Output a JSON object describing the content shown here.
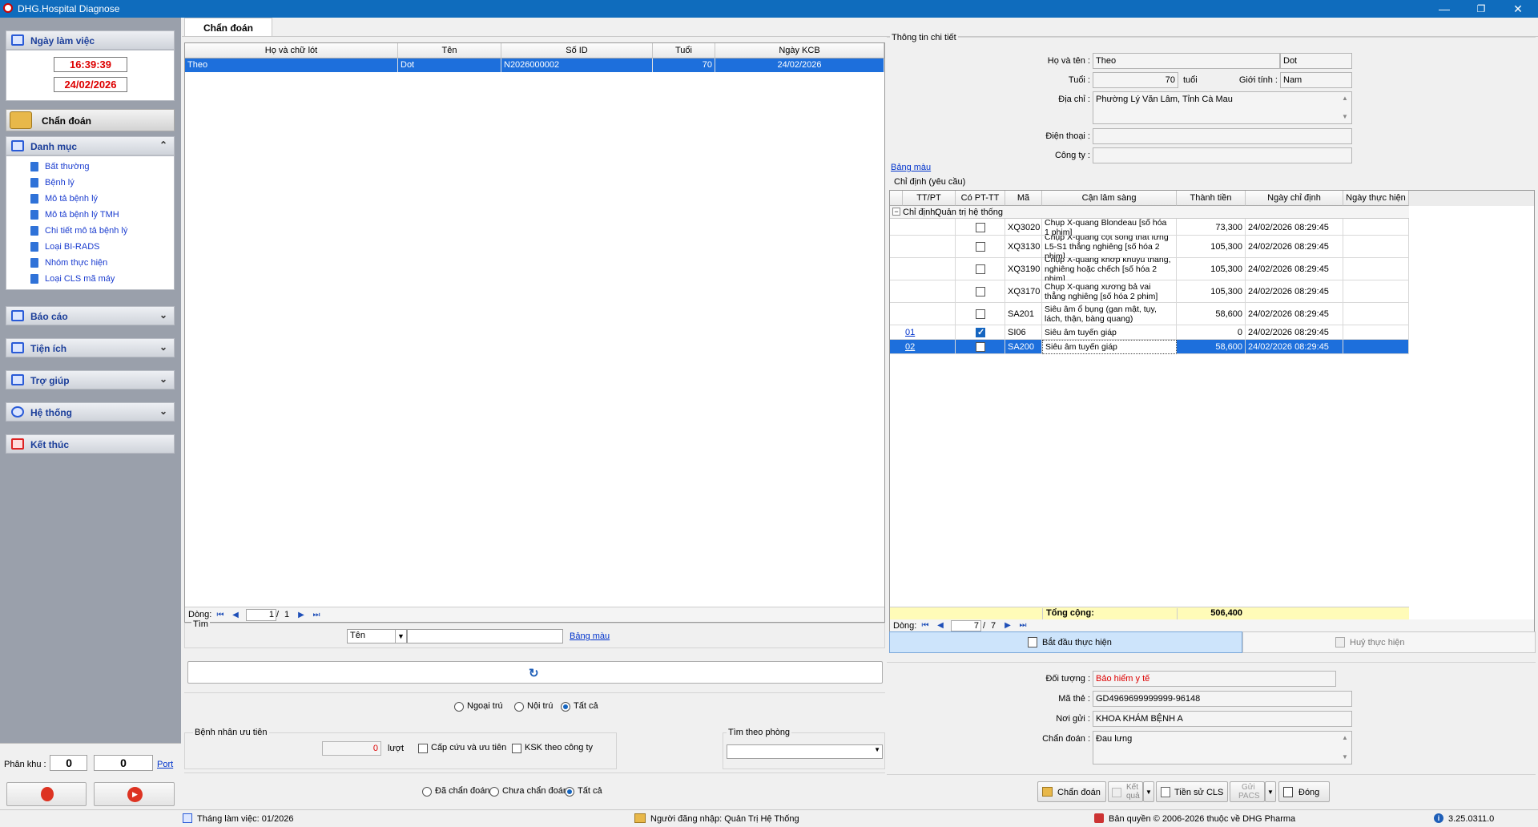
{
  "window": {
    "title": "DHG.Hospital Diagnose"
  },
  "sidebar": {
    "workday_title": "Ngày làm việc",
    "time": "16:39:39",
    "date": "24/02/2026",
    "diagnose_label": "Chẩn đoán",
    "catalog_title": "Danh mục",
    "catalog_items": [
      "Bất thường",
      "Bệnh lý",
      "Mô tả bệnh lý",
      "Mô tả bệnh lý TMH",
      "Chi tiết mô tả bệnh lý",
      "Loại BI-RADS",
      "Nhóm thực hiện",
      "Loại CLS mã máy"
    ],
    "report_title": "Báo cáo",
    "utility_title": "Tiện ích",
    "help_title": "Trợ giúp",
    "system_title": "Hệ thống",
    "exit_title": "Kết thúc",
    "zone_label": "Phân khu :",
    "zone_value1": "0",
    "zone_value2": "0",
    "port_link": "Port"
  },
  "tab": {
    "label": "Chẩn đoán"
  },
  "patient_grid": {
    "headers": [
      "Họ và chữ lót",
      "Tên",
      "Số ID",
      "Tuổi",
      "Ngày KCB"
    ],
    "rows": [
      [
        "Theo",
        "Dot",
        "N2026000002",
        "70",
        "24/02/2026"
      ]
    ],
    "nav_label": "Dòng:",
    "page_current": "1",
    "page_total": "1"
  },
  "search": {
    "title": "Tìm",
    "field_select": "Tên",
    "value": "",
    "color_link": "Bảng màu"
  },
  "filters": {
    "visit_options": [
      "Ngoại trú",
      "Nội trú",
      "Tất cả"
    ],
    "priority_title": "Bệnh nhân ưu tiên",
    "priority_count": "0",
    "priority_unit": "lượt",
    "emergency_label": "Cấp cứu và ưu tiên",
    "ksk_label": "KSK theo công ty",
    "room_title": "Tìm theo phòng",
    "room_value": "",
    "diag_options": [
      "Đã chẩn đoán",
      "Chưa chẩn đoán",
      "Tất cả"
    ]
  },
  "details": {
    "title": "Thông tin chi tiết",
    "name_label": "Họ và tên :",
    "last_name": "Theo",
    "first_name": "Dot",
    "age_label": "Tuổi :",
    "age": "70",
    "age_unit": "tuổi",
    "gender_label": "Giới tính :",
    "gender": "Nam",
    "address_label": "Địa chỉ :",
    "address": "Phường Lý Văn Lâm, Tỉnh Cà Mau",
    "phone_label": "Điện thoại :",
    "phone": "",
    "company_label": "Công ty :",
    "company": "",
    "color_link": "Bảng màu"
  },
  "orders": {
    "title": "Chỉ định (yêu cầu)",
    "headers": [
      "TT/PT",
      "Có PT-TT",
      "Mã",
      "Cận lâm sàng",
      "Thành tiền",
      "Ngày chỉ định",
      "Ngày thực hiện"
    ],
    "group_label": "Chỉ định:",
    "group_value": "Quản trị hệ thống",
    "rows": [
      {
        "tt": "",
        "checked": false,
        "code": "XQ3020",
        "name": "Chụp X-quang Blondeau [số hóa 1 phim]",
        "price": "73,300",
        "date": "24/02/2026 08:29:45",
        "done": ""
      },
      {
        "tt": "",
        "checked": false,
        "code": "XQ3130",
        "name": "Chụp X-quang cột sống thắt lưng L5-S1 thẳng nghiêng [số hóa 2 phim]",
        "price": "105,300",
        "date": "24/02/2026 08:29:45",
        "done": ""
      },
      {
        "tt": "",
        "checked": false,
        "code": "XQ3190",
        "name": "Chụp X-quang khớp khuỷu thẳng, nghiêng hoặc chếch [số hóa 2 phim]",
        "price": "105,300",
        "date": "24/02/2026 08:29:45",
        "done": ""
      },
      {
        "tt": "",
        "checked": false,
        "code": "XQ3170",
        "name": "Chụp X-quang xương bả vai thẳng nghiêng [số hóa 2 phim]",
        "price": "105,300",
        "date": "24/02/2026 08:29:45",
        "done": ""
      },
      {
        "tt": "",
        "checked": false,
        "code": "SA201",
        "name": "Siêu âm ổ bụng (gan mật, tụy, lách, thận, bàng quang)",
        "price": "58,600",
        "date": "24/02/2026 08:29:45",
        "done": ""
      },
      {
        "tt": "01",
        "checked": true,
        "code": "SI06",
        "name": "Siêu âm tuyến giáp",
        "price": "0",
        "date": "24/02/2026 08:29:45",
        "done": ""
      },
      {
        "tt": "02",
        "checked": false,
        "code": "SA200",
        "name": "Siêu âm tuyến giáp",
        "price": "58,600",
        "date": "24/02/2026 08:29:45",
        "done": ""
      }
    ],
    "total_label": "Tổng cộng:",
    "total_value": "506,400",
    "nav_label": "Dòng:",
    "page_current": "7",
    "page_total": "7",
    "start_button": "Bắt đầu thực hiện",
    "cancel_button": "Huỷ thực hiện"
  },
  "insurance": {
    "object_label": "Đối tượng :",
    "object_value": "Bảo hiểm y tế",
    "card_label": "Mã thẻ :",
    "card_value": "GD4969699999999-96148",
    "sender_label": "Nơi gửi :",
    "sender_value": "KHOA KHÁM BỆNH A",
    "diagnosis_label": "Chẩn đoán :",
    "diagnosis_value": "Đau lưng"
  },
  "actions": {
    "diagnose": "Chẩn đoán",
    "result_line1": "Kết",
    "result_line2": "quả",
    "history": "Tiền sử CLS",
    "pacs_line1": "Gửi",
    "pacs_line2": "PACS",
    "close": "Đóng"
  },
  "status": {
    "month": "Tháng làm việc: 01/2026",
    "user": "Người đăng nhập: Quản Trị Hệ Thống",
    "copyright": "Bản quyền © 2006-2026 thuộc về DHG Pharma",
    "version": "3.25.0311.0"
  }
}
